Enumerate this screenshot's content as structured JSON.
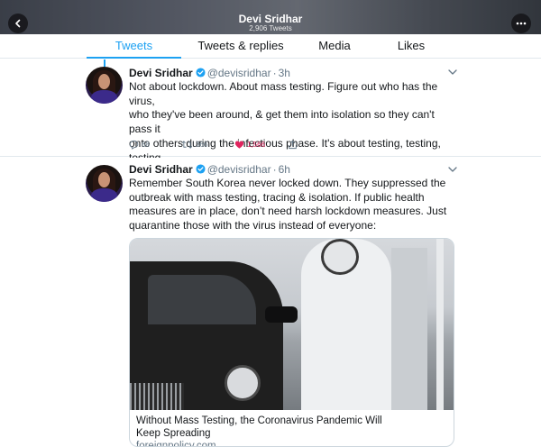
{
  "header": {
    "title": "Devi Sridhar",
    "subtitle": "2,906 Tweets",
    "back_icon": "chevron-left-icon",
    "more_icon": "ellipsis-icon"
  },
  "tabs": [
    {
      "label": "Tweets",
      "active": true
    },
    {
      "label": "Tweets & replies",
      "active": false
    },
    {
      "label": "Media",
      "active": false
    },
    {
      "label": "Likes",
      "active": false
    }
  ],
  "colors": {
    "accent": "#1da1f2",
    "like": "#e0245e",
    "secondary_text": "#657786"
  },
  "tweets": [
    {
      "name": "Devi Sridhar",
      "handle": "@devisridhar",
      "separator": "·",
      "time": "3h",
      "text_lines": [
        "Not about lockdown. About mass testing. Figure out who has the virus,",
        "who they've been around, & get them into isolation so they can't pass it",
        "onto others during the infectious phase. It's about testing, testing,",
        "testing."
      ],
      "replies": "68",
      "retweets": "366",
      "likes": "1,566",
      "liked": true
    },
    {
      "name": "Devi Sridhar",
      "handle": "@devisridhar",
      "separator": "·",
      "time": "6h",
      "text_lines": [
        "Remember South Korea never locked down. They suppressed the",
        "outbreak with mass testing, tracing & isolation. If public health",
        "measures are in place, don’t need harsh lockdown measures. Just",
        "quarantine those with the virus instead of everyone:"
      ],
      "card": {
        "title_lines": [
          "Without Mass Testing, the Coronavirus Pandemic Will",
          "Keep Spreading"
        ],
        "domain": "foreignpolicy.com"
      }
    }
  ]
}
